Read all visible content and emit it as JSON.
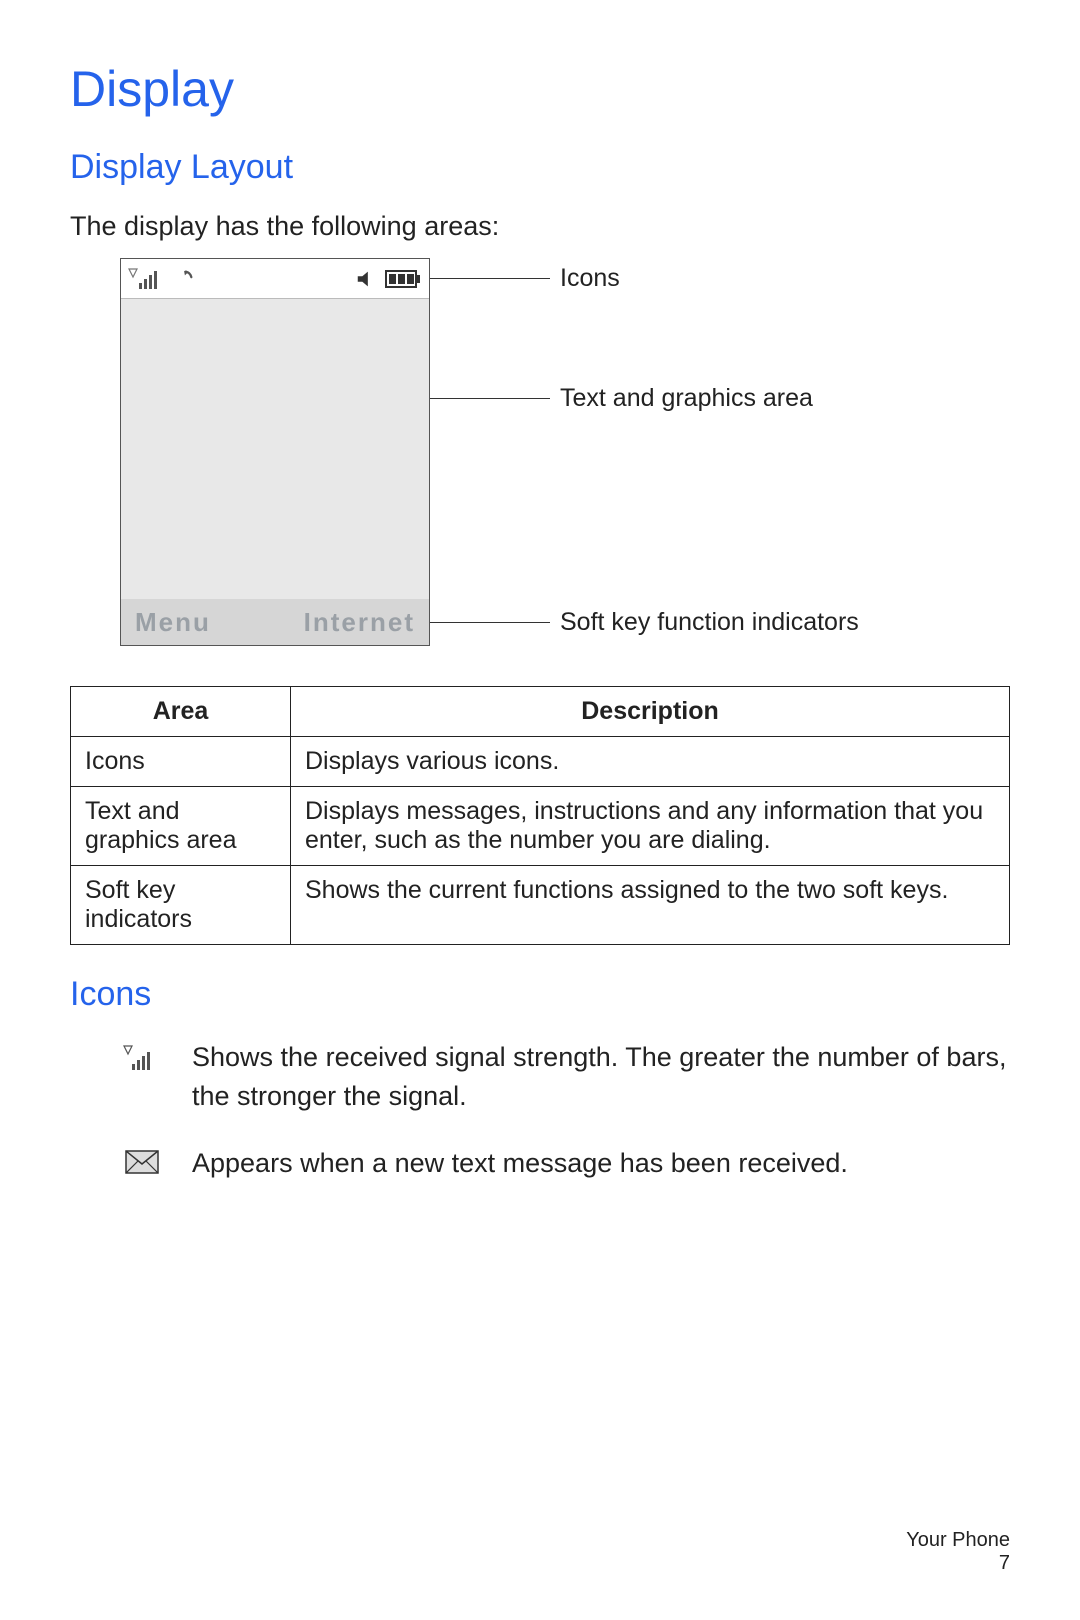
{
  "title": "Display",
  "subsection1": "Display Layout",
  "intro": "The display has the following areas:",
  "phone": {
    "softkey_left": "Menu",
    "softkey_right": "Internet"
  },
  "callouts": {
    "icons": "Icons",
    "textarea": "Text and graphics area",
    "softkeys": "Soft key function indicators"
  },
  "table": {
    "headers": {
      "area": "Area",
      "description": "Description"
    },
    "rows": [
      {
        "area": "Icons",
        "description": "Displays various icons."
      },
      {
        "area": "Text and graphics area",
        "description": "Displays messages, instructions and any information that you enter, such as the number you are dialing."
      },
      {
        "area": "Soft key indicators",
        "description": "Shows the current functions assigned to the two soft keys."
      }
    ]
  },
  "subsection2": "Icons",
  "legend": [
    {
      "icon": "signal",
      "text": "Shows the received signal strength. The greater the number of bars, the stronger the signal."
    },
    {
      "icon": "message",
      "text": "Appears when a new text message has been received."
    }
  ],
  "footer": {
    "section": "Your Phone",
    "page": "7"
  }
}
